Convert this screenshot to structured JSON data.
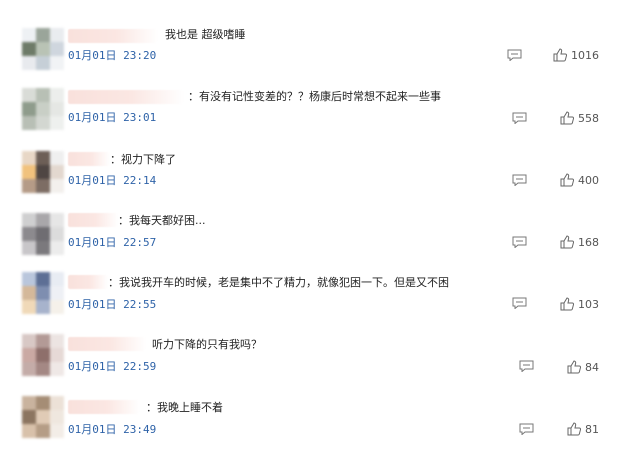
{
  "comments": [
    {
      "text": "我也是 超级嗜睡",
      "time": "01月01日 23:20",
      "likes": "1016",
      "palette": [
        "#eef1f4",
        "#9aa59a",
        "#e9ecef",
        "#6e7b68",
        "#b9c3b5",
        "#cfd6de",
        "#e8eaee",
        "#c6cfd7",
        "#f1f3f5"
      ]
    },
    {
      "text": "：有没有记性变差的？？杨康后时常想不起来一些事",
      "time": "01月01日 23:01",
      "likes": "558",
      "palette": [
        "#d9dcd7",
        "#b8c0b5",
        "#eceeec",
        "#8f9c8c",
        "#c9cfc6",
        "#e5e7e4",
        "#b8bfb5",
        "#d3d7d1",
        "#eef0ee"
      ]
    },
    {
      "text": "：视力下降了",
      "time": "01月01日 22:14",
      "likes": "400",
      "palette": [
        "#e8d7c6",
        "#6d5f57",
        "#efefef",
        "#f1c27d",
        "#4f4643",
        "#e3d8cf",
        "#b59b87",
        "#7d6d64",
        "#f3f0ed"
      ]
    },
    {
      "text": "：我每天都好困...",
      "time": "01月01日 22:57",
      "likes": "168",
      "palette": [
        "#cfcfd0",
        "#a9a7aa",
        "#e6e6e6",
        "#8c8a8e",
        "#6f6d72",
        "#dcdcdc",
        "#c8c6c9",
        "#7b797d",
        "#ececec"
      ]
    },
    {
      "text": "：我说我开车的时候，老是集中不了精力，就像犯困一下。但是又不困",
      "time": "01月01日 22:55",
      "likes": "103",
      "palette": [
        "#b9c6dc",
        "#5d6f95",
        "#e8ecf3",
        "#d4b89a",
        "#7e8eb0",
        "#eef0f5",
        "#f0d9b8",
        "#a7b3cc",
        "#f5f1ea"
      ]
    },
    {
      "text": "听力下降的只有我吗？",
      "time": "01月01日 22:59",
      "likes": "84",
      "palette": [
        "#d8c8c5",
        "#b39a96",
        "#ece4e2",
        "#caa9a3",
        "#8e6f6b",
        "#e6d9d6",
        "#c4aca8",
        "#a48884",
        "#efe8e6"
      ]
    },
    {
      "text": "：我晚上睡不着",
      "time": "01月01日 23:49",
      "likes": "81",
      "palette": [
        "#c9b39e",
        "#a58d75",
        "#ece1d7",
        "#8c7560",
        "#e0cbb6",
        "#efe7df",
        "#d8c1aa",
        "#b59d86",
        "#f3ede7"
      ]
    }
  ],
  "icons": {
    "reply": "comment-reply-icon",
    "like": "thumbs-up-icon"
  }
}
